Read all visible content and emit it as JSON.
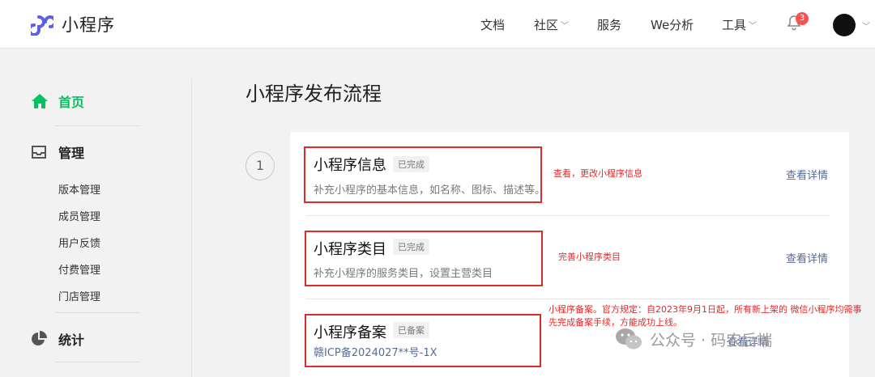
{
  "app": {
    "title": "小程序"
  },
  "topnav": {
    "docs": "文档",
    "community": "社区",
    "services": "服务",
    "analytics": "We分析",
    "tools": "工具",
    "notification_count": "3"
  },
  "sidebar": {
    "home": "首页",
    "manage": "管理",
    "manage_items": [
      "版本管理",
      "成员管理",
      "用户反馈",
      "付费管理",
      "门店管理"
    ],
    "stats": "统计"
  },
  "main": {
    "title": "小程序发布流程",
    "step_number": "1",
    "items": [
      {
        "title": "小程序信息",
        "tag": "已完成",
        "desc": "补充小程序的基本信息，如名称、图标、描述等。",
        "link": "查看详情",
        "note": "查看，更改小程序信息"
      },
      {
        "title": "小程序类目",
        "tag": "已完成",
        "desc": "补充小程序的服务类目，设置主营类目",
        "link": "查看详情",
        "note": "完善小程序类目"
      },
      {
        "title": "小程序备案",
        "tag": "已备案",
        "desc": "赣ICP备2024027**号-1X",
        "link": "查看详情",
        "note": "小程序备案。官方规定：自2023年9月1日起，所有新上架的 微信小程序均需事先完成备案手续，方能成功上线。"
      }
    ]
  },
  "watermark": {
    "text": "公众号 · 码农后端"
  },
  "colors": {
    "accent": "#07c160",
    "red": "#e12a2a",
    "link": "#576b95",
    "badge": "#fa5151"
  }
}
